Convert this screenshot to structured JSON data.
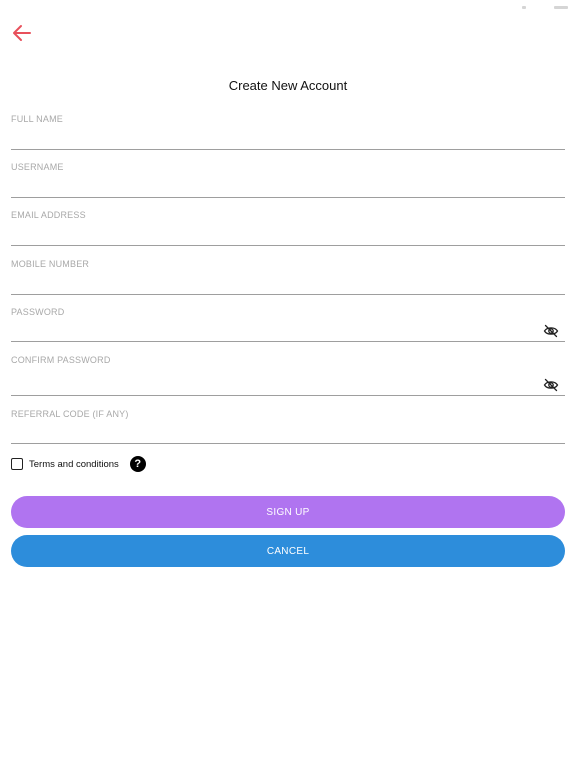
{
  "header": {
    "back_icon": "arrow-left-icon",
    "title": "Create New Account"
  },
  "form": {
    "fields": [
      {
        "label": "FULL NAME",
        "value": ""
      },
      {
        "label": "USERNAME",
        "value": ""
      },
      {
        "label": "EMAIL ADDRESS",
        "value": ""
      },
      {
        "label": "MOBILE NUMBER",
        "value": ""
      },
      {
        "label": "PASSWORD",
        "value": "",
        "icon": "eye-off-icon"
      },
      {
        "label": "CONFIRM PASSWORD",
        "value": "",
        "icon": "eye-off-icon"
      },
      {
        "label": "REFERRAL CODE (IF ANY)",
        "value": ""
      }
    ],
    "terms_label": "Terms and conditions",
    "terms_checked": false,
    "help_icon": "question-circle-icon",
    "help_glyph": "?"
  },
  "actions": {
    "signup_label": "SIGN UP",
    "cancel_label": "CANCEL"
  },
  "colors": {
    "accent_back": "#e8505b",
    "signup_bg": "#b074f0",
    "cancel_bg": "#2d8ddb",
    "label": "#a8a8a8",
    "divider": "#9e9e9e"
  }
}
